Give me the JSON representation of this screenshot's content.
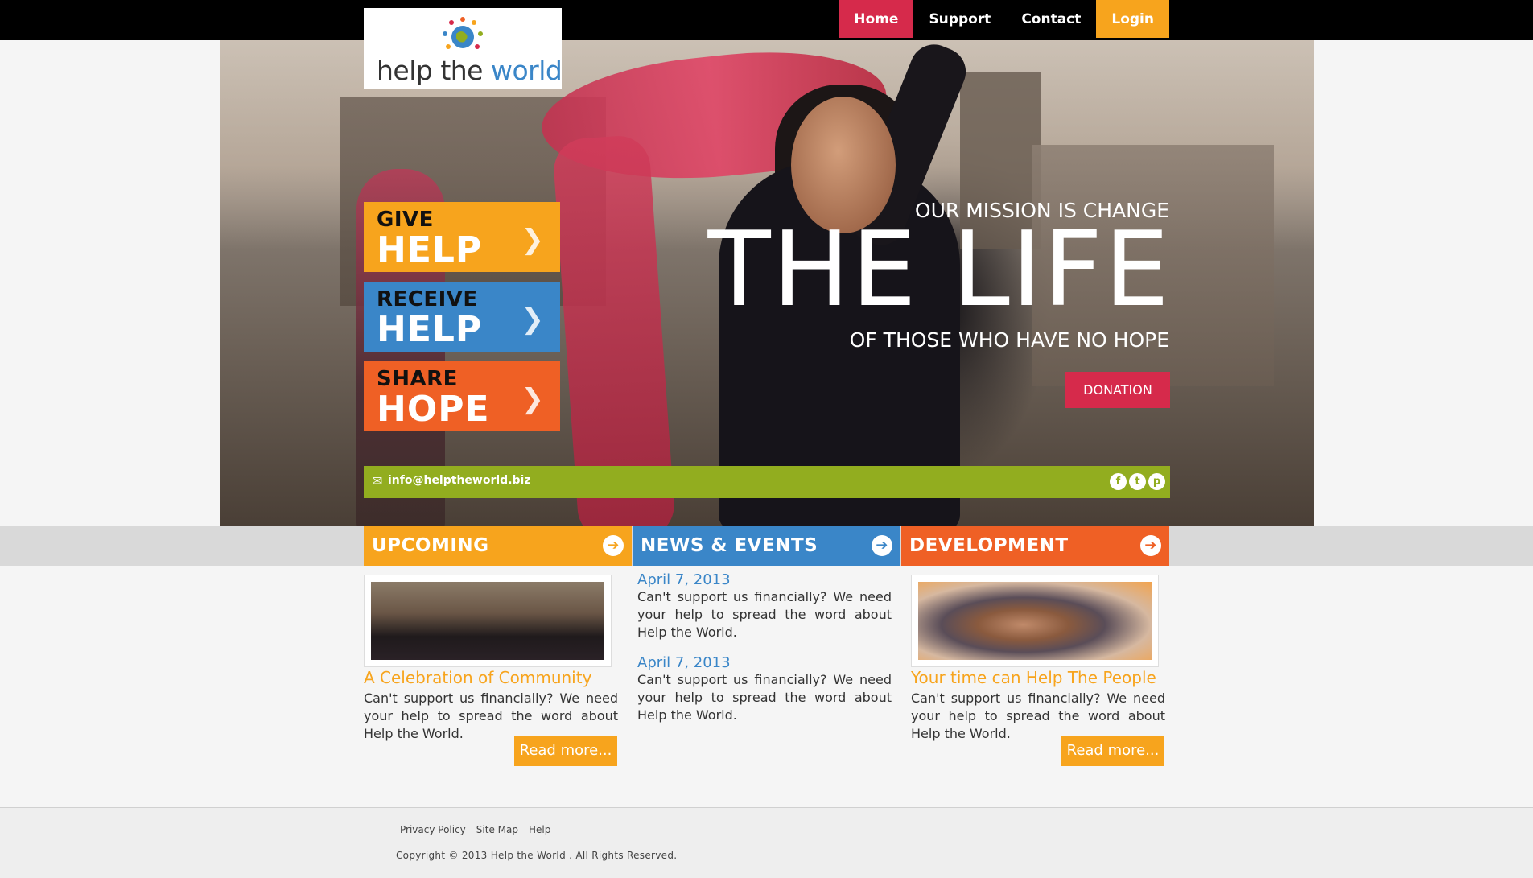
{
  "brand": {
    "logo_text_part1": "help the ",
    "logo_text_part2": "world"
  },
  "nav": {
    "items": [
      {
        "label": "Home"
      },
      {
        "label": "Support"
      },
      {
        "label": "Contact"
      },
      {
        "label": "Login"
      }
    ]
  },
  "hero": {
    "buttons": [
      {
        "small": "GIVE",
        "big": "HELP",
        "color": "#f7a41d"
      },
      {
        "small": "RECEIVE",
        "big": "HELP",
        "color": "#3a86c8"
      },
      {
        "small": "SHARE",
        "big": "HOPE",
        "color": "#ef6025"
      }
    ],
    "mission_line1": "OUR MISSION IS CHANGE",
    "mission_big": "THE LIFE",
    "mission_line3": "OF THOSE WHO HAVE NO HOPE",
    "donation_label": "DONATION",
    "email": "info@helptheworld.biz",
    "social_icons": [
      "facebook-icon",
      "twitter-icon",
      "pinterest-icon"
    ]
  },
  "columns": {
    "upcoming": {
      "header": "UPCOMING",
      "title": "A Celebration of Community",
      "text": "Can't support us financially? We need your help to spread the word about Help the World.",
      "read_more": "Read more..."
    },
    "news": {
      "header": "NEWS & EVENTS",
      "items": [
        {
          "date": "April 7, 2013",
          "text": "Can't support us financially? We need your help to spread the word about Help the World."
        },
        {
          "date": "April 7, 2013",
          "text": "Can't support us financially? We need your help to spread the word about Help the World."
        }
      ]
    },
    "development": {
      "header": "DEVELOPMENT",
      "title": "Your time can Help The People",
      "text": "Can't support us financially? We need your help to spread the word about Help the World.",
      "read_more": "Read more..."
    }
  },
  "footer": {
    "links": [
      "Privacy Policy",
      "Site Map",
      "Help"
    ],
    "copyright": "Copyright © 2013 Help the World . All Rights Reserved."
  },
  "colors": {
    "yellow": "#f7a41d",
    "blue": "#3a86c8",
    "orange": "#ef6025",
    "red": "#d62a4b",
    "green": "#92ad1f"
  }
}
